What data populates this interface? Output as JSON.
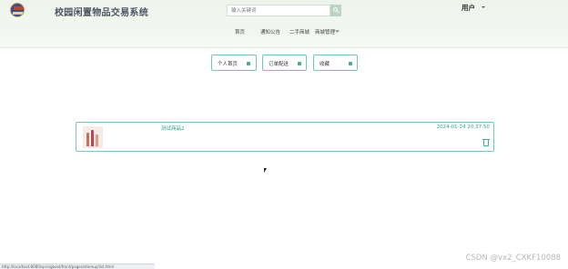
{
  "site": {
    "title": "校园闲置物品交易系统"
  },
  "search": {
    "placeholder": "输入关键词"
  },
  "user": {
    "label": "用户"
  },
  "nav": {
    "home": "首页",
    "notice": "通知公告",
    "market": "二手商城",
    "mall": "商城管理"
  },
  "tabs": [
    {
      "label": "个人首页"
    },
    {
      "label": "订单配送"
    },
    {
      "label": "收藏"
    }
  ],
  "favorite_item": {
    "name": "测试商品2",
    "time": "2024-01-24 20:37:50"
  },
  "status_bar": {
    "text": "http://localhost:8080/springboot/front/pages/storeup/list.html"
  },
  "watermark": {
    "text": "CSDN @vx2_CXKF10088"
  },
  "colors": {
    "accent": "#29a48c",
    "border": "#7cc8b8",
    "header_bg": "#eef4ec"
  }
}
